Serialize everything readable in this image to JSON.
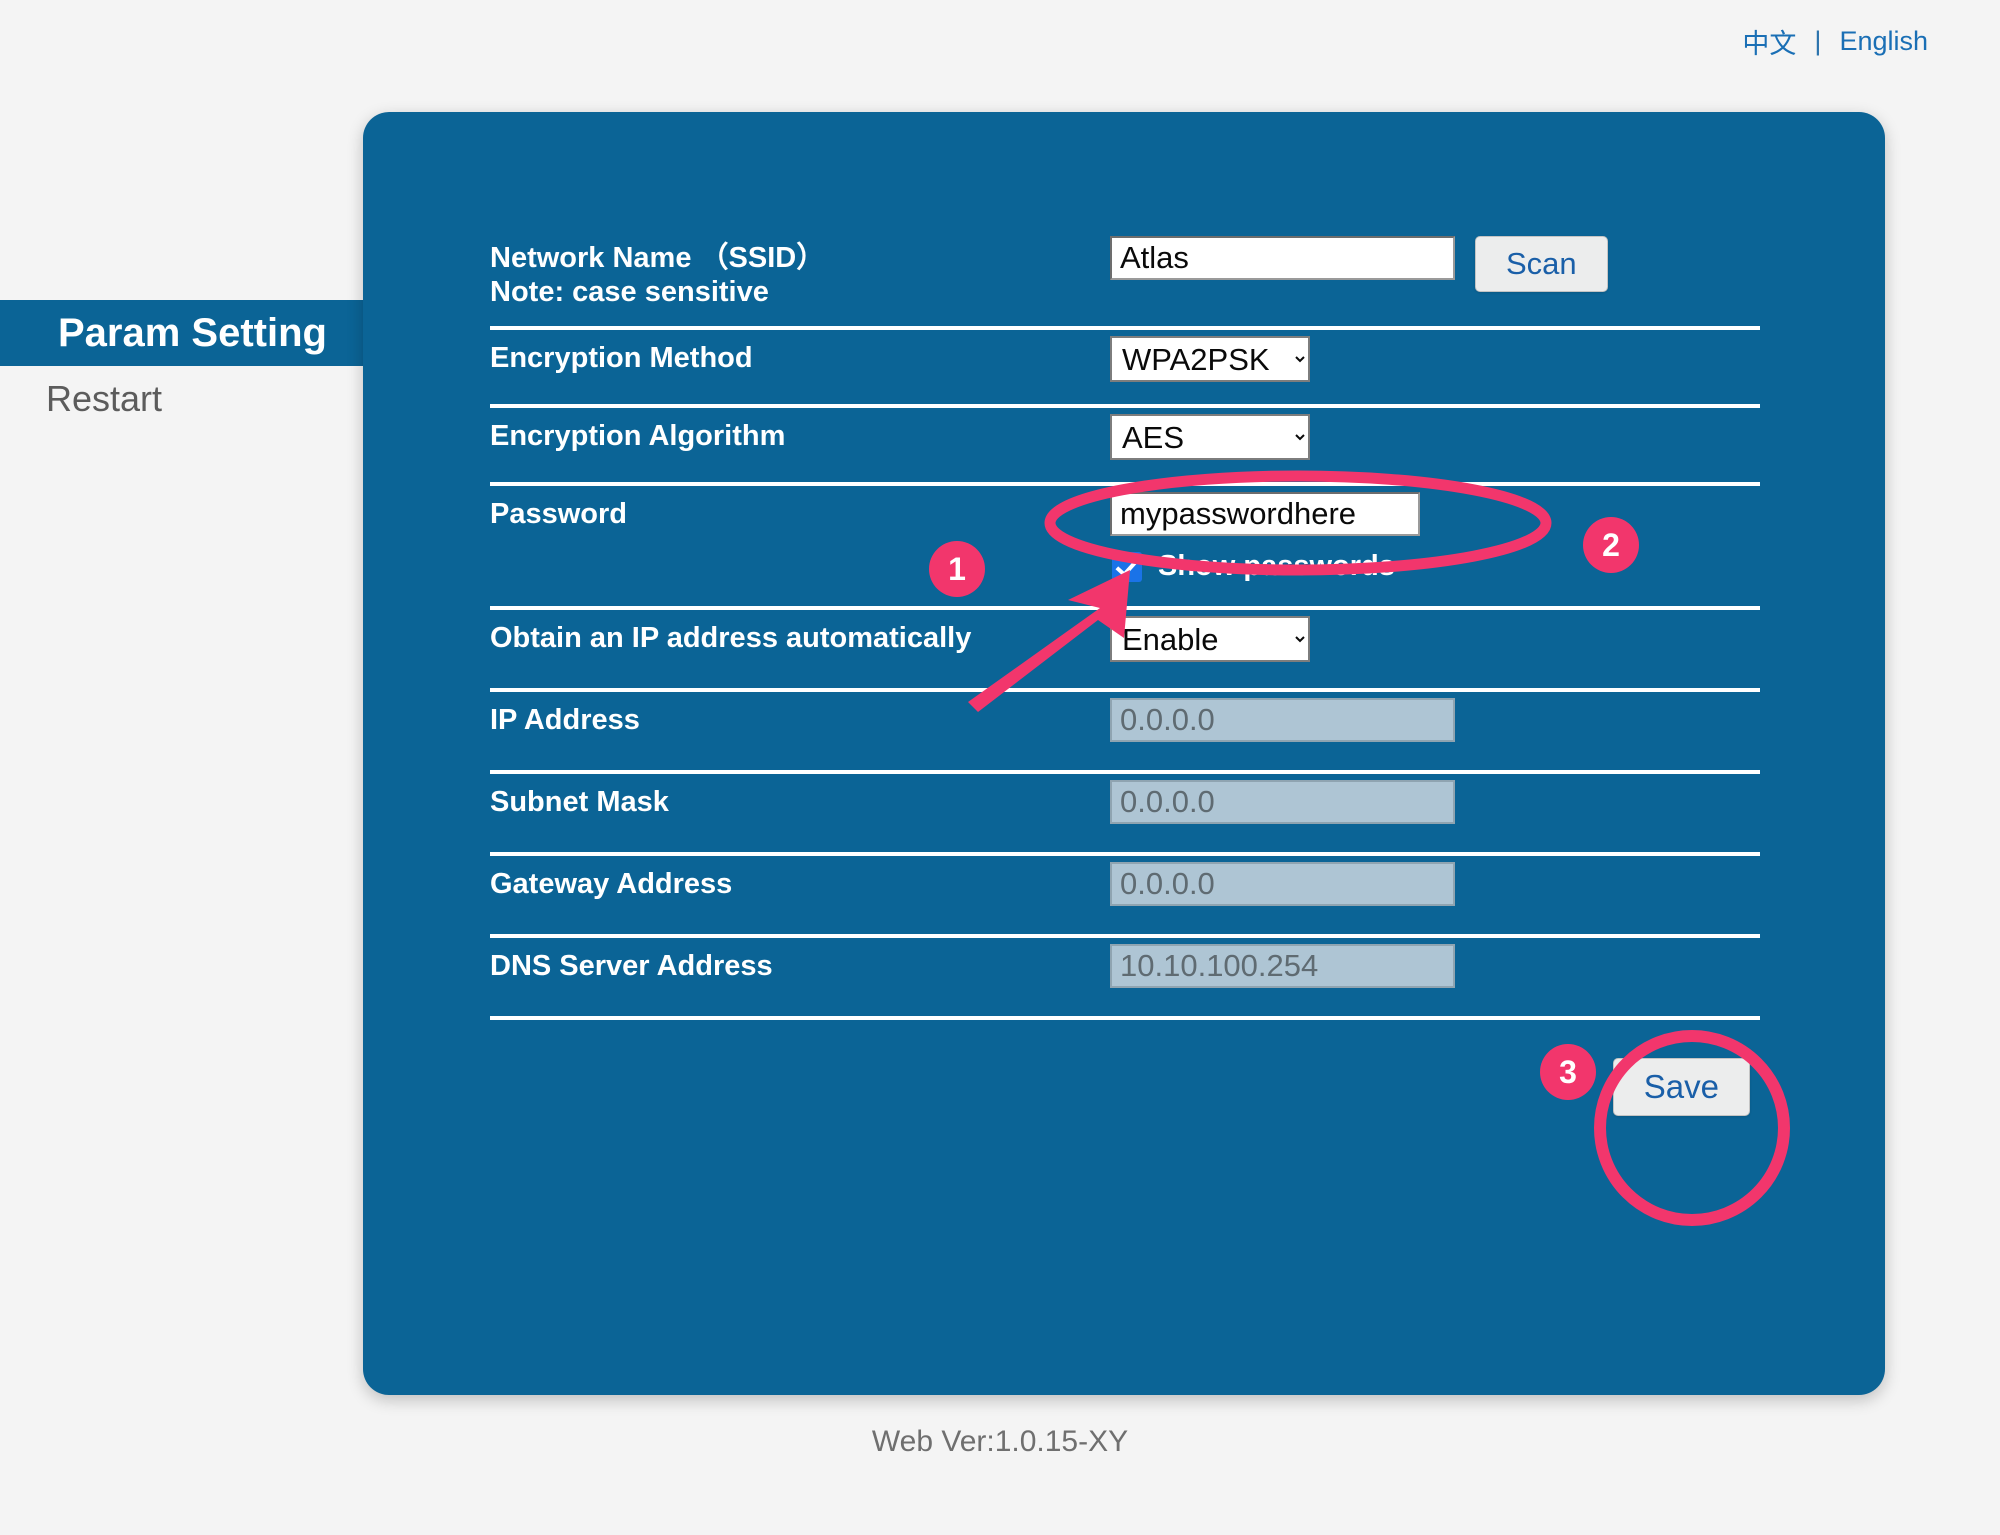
{
  "language_bar": {
    "chinese_label": "中文",
    "separator": "|",
    "english_label": "English"
  },
  "side_nav": {
    "items": [
      {
        "label": "Param Setting",
        "active": true
      },
      {
        "label": "Restart",
        "active": false
      }
    ]
  },
  "form": {
    "ssid": {
      "label": "Network Name （SSID）",
      "note": "Note: case sensitive",
      "value": "Atlas",
      "placeholder": "",
      "scan_button": "Scan"
    },
    "encryption_method": {
      "label": "Encryption Method",
      "value": "WPA2PSK",
      "options": [
        "WPA2PSK"
      ]
    },
    "encryption_algorithm": {
      "label": "Encryption Algorithm",
      "value": "AES",
      "options": [
        "AES"
      ]
    },
    "password": {
      "label": "Password",
      "value": "mypasswordhere",
      "placeholder": "",
      "show_passwords_label": "Show passwords",
      "show_passwords_checked": true
    },
    "dhcp": {
      "label": "Obtain an IP address automatically",
      "value": "Enable",
      "options": [
        "Enable"
      ]
    },
    "ip_address": {
      "label": "IP Address",
      "value": "0.0.0.0",
      "disabled": true
    },
    "subnet_mask": {
      "label": "Subnet Mask",
      "value": "0.0.0.0",
      "disabled": true
    },
    "gateway_address": {
      "label": "Gateway Address",
      "value": "0.0.0.0",
      "disabled": true
    },
    "dns_server_address": {
      "label": "DNS Server Address",
      "value": "10.10.100.254",
      "disabled": true
    },
    "save_button": "Save"
  },
  "footer": {
    "version_text": "Web Ver:1.0.15-XY"
  },
  "annotations": {
    "accent_color": "#f2366c",
    "step_1": "1",
    "step_2": "2",
    "step_3": "3"
  },
  "colors": {
    "panel_blue": "#0b6496",
    "page_background": "#f4f4f4",
    "link_blue": "#1a6fb5",
    "checkbox_blue": "#1a73e8",
    "disabled_field": "#aec5d4"
  }
}
